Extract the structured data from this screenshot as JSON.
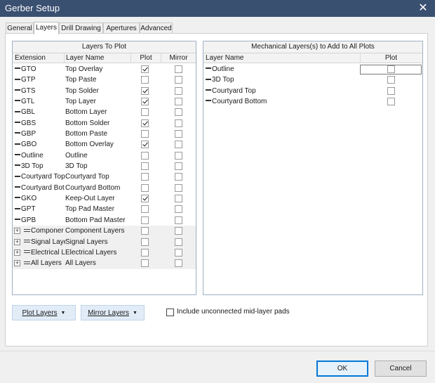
{
  "window": {
    "title": "Gerber Setup",
    "close_glyph": "✕"
  },
  "tabs": [
    {
      "label": "General",
      "active": false
    },
    {
      "label": "Layers",
      "active": true
    },
    {
      "label": "Drill Drawing",
      "active": false
    },
    {
      "label": "Apertures",
      "active": false
    },
    {
      "label": "Advanced",
      "active": false
    }
  ],
  "layers_to_plot": {
    "caption": "Layers To Plot",
    "columns": {
      "extension": "Extension",
      "layer_name": "Layer Name",
      "plot": "Plot",
      "mirror": "Mirror"
    },
    "rows": [
      {
        "extension": "GTO",
        "name": "Top Overlay",
        "plot": true,
        "mirror": false
      },
      {
        "extension": "GTP",
        "name": "Top Paste",
        "plot": false,
        "mirror": false
      },
      {
        "extension": "GTS",
        "name": "Top Solder",
        "plot": true,
        "mirror": false
      },
      {
        "extension": "GTL",
        "name": "Top Layer",
        "plot": true,
        "mirror": false
      },
      {
        "extension": "GBL",
        "name": "Bottom Layer",
        "plot": false,
        "mirror": false
      },
      {
        "extension": "GBS",
        "name": "Bottom Solder",
        "plot": true,
        "mirror": false
      },
      {
        "extension": "GBP",
        "name": "Bottom Paste",
        "plot": false,
        "mirror": false
      },
      {
        "extension": "GBO",
        "name": "Bottom Overlay",
        "plot": true,
        "mirror": false
      },
      {
        "extension": "Outline",
        "name": "Outline",
        "plot": false,
        "mirror": false
      },
      {
        "extension": "3D Top",
        "name": "3D Top",
        "plot": false,
        "mirror": false
      },
      {
        "extension": "Courtyard Top",
        "name": "Courtyard Top",
        "plot": false,
        "mirror": false
      },
      {
        "extension": "Courtyard Bot",
        "name": "Courtyard Bottom",
        "plot": false,
        "mirror": false
      },
      {
        "extension": "GKO",
        "name": "Keep-Out Layer",
        "plot": true,
        "mirror": false
      },
      {
        "extension": "GPT",
        "name": "Top Pad Master",
        "plot": false,
        "mirror": false
      },
      {
        "extension": "GPB",
        "name": "Bottom Pad Master",
        "plot": false,
        "mirror": false
      }
    ],
    "groups": [
      {
        "extension": "Componer",
        "name": "Component Layers",
        "plot": false,
        "mirror": false
      },
      {
        "extension": "Signal Laye",
        "name": "Signal Layers",
        "plot": false,
        "mirror": false
      },
      {
        "extension": "Electrical L",
        "name": "Electrical Layers",
        "plot": false,
        "mirror": false
      },
      {
        "extension": "All Layers",
        "name": "All Layers",
        "plot": false,
        "mirror": false
      }
    ],
    "expander_glyph": "+"
  },
  "mechanical": {
    "caption": "Mechanical Layers(s) to Add to All Plots",
    "columns": {
      "layer_name": "Layer Name",
      "plot": "Plot"
    },
    "rows": [
      {
        "name": "Outline",
        "plot": false
      },
      {
        "name": "3D Top",
        "plot": false
      },
      {
        "name": "Courtyard Top",
        "plot": false
      },
      {
        "name": "Courtyard Bottom",
        "plot": false
      }
    ]
  },
  "controls": {
    "plot_layers": "Plot Layers",
    "mirror_layers": "Mirror Layers",
    "caret": "▼",
    "include_unconnected": "Include unconnected mid-layer pads",
    "include_unconnected_checked": false
  },
  "footer": {
    "ok": "OK",
    "cancel": "Cancel"
  }
}
